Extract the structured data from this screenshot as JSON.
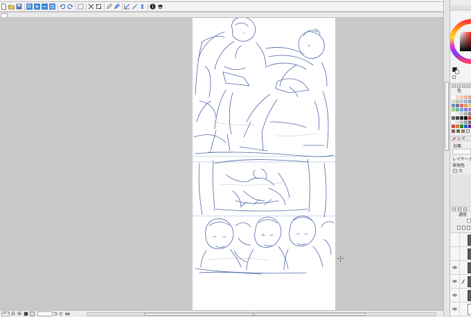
{
  "toolbar": {
    "buttons": [
      "new-file-icon",
      "open-file-icon",
      "save-icon",
      "zoom-icon",
      "zoom-in-icon",
      "zoom-out-icon",
      "fit-icon",
      "undo-icon",
      "redo-icon",
      "select-all-icon",
      "clear-icon",
      "transform-icon",
      "pen-icon",
      "blue-pen-icon",
      "shape-icon",
      "ruler-icon",
      "snap-icon",
      "info-icon",
      "learn-icon"
    ],
    "accent_color": "#2a63c8"
  },
  "status_bar": {
    "zoom": "26.8"
  },
  "panels": {
    "color_set_title": "色",
    "layer_property_title": "レイ",
    "effect_label": "効果",
    "layer_color_label": "レイヤーカ",
    "expression_color_label": "表現色",
    "expression_color_value": "カ",
    "blend_mode": "通常"
  },
  "swatches": [
    "#ffffff",
    "#f7d5c6",
    "#f5c9b0",
    "#efb89a",
    "#e8a58a",
    "#d6d6d6",
    "#c8bfa8",
    "#b1c6d9",
    "#9bb5cf",
    "#8aa0bf",
    "#7a8fb0",
    "#6c7a9a",
    "#d96b6b",
    "#e0996a",
    "#e7c46b",
    "#9ccf7a",
    "#6ab7a0",
    "#6aa7d8",
    "#7a83d8",
    "#a77ad8",
    "#ffffff",
    "#eeeeee",
    "#cccccc",
    "#aaaaaa",
    "#888888",
    "#666666",
    "#444444",
    "#222222",
    "#000000",
    "#c0392b",
    "#f2f2f2",
    "#e0e0e0",
    "#bcbcbc",
    "#9a9a9a",
    "#6f6f6f",
    "#d14848",
    "#d27d2d",
    "#2e7d32",
    "#1565c0",
    "#6a1b9a"
  ],
  "colors": {
    "main_color": "#151515",
    "sub_color": "#ffffff",
    "sketch_line": "#3a55a0"
  },
  "layers": [
    {
      "visible": false,
      "locked": false,
      "thumbnail": "dark"
    },
    {
      "visible": false,
      "locked": false,
      "thumbnail": "dark"
    },
    {
      "visible": true,
      "locked": false,
      "thumbnail": "dark"
    },
    {
      "visible": true,
      "locked": true,
      "thumbnail": "dark"
    },
    {
      "visible": true,
      "locked": false,
      "thumbnail": "dark"
    },
    {
      "visible": true,
      "locked": false,
      "thumbnail": "white"
    }
  ]
}
